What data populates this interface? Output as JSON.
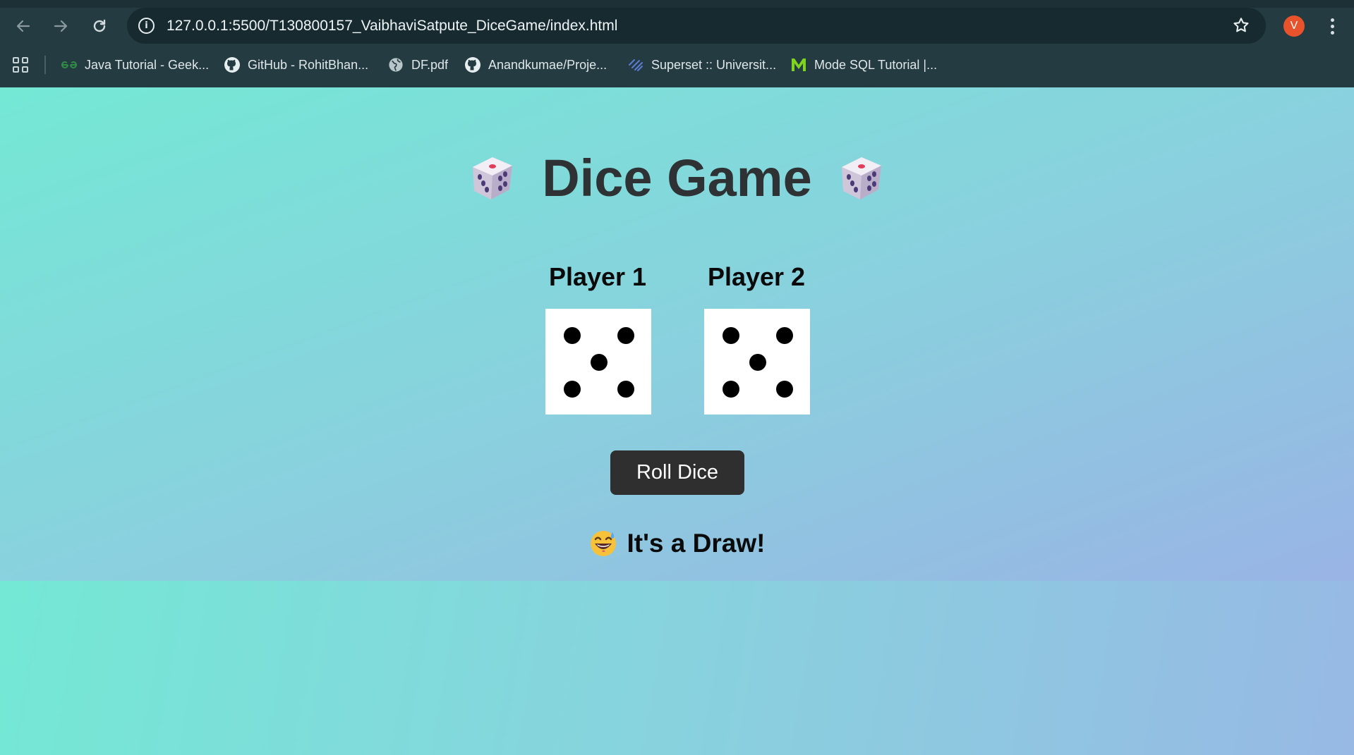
{
  "browser": {
    "url": "127.0.0.1:5500/T130800157_VaibhaviSatpute_DiceGame/index.html",
    "avatar_letter": "V",
    "avatar_color": "#e8532b",
    "bookmarks": [
      {
        "label": "Java Tutorial - Geek...",
        "icon": "geeksforgeeks-icon"
      },
      {
        "label": "GitHub - RohitBhan...",
        "icon": "github-icon"
      },
      {
        "label": "DF.pdf",
        "icon": "globe-icon"
      },
      {
        "label": "Anandkumae/Proje...",
        "icon": "github-icon"
      },
      {
        "label": "Superset :: Universit...",
        "icon": "superset-icon"
      },
      {
        "label": "Mode SQL Tutorial |...",
        "icon": "mode-icon"
      }
    ]
  },
  "game": {
    "title": "Dice Game",
    "players": [
      {
        "label": "Player 1",
        "die_value": 5
      },
      {
        "label": "Player 2",
        "die_value": 5
      }
    ],
    "roll_button_label": "Roll Dice",
    "result_text": "It's a Draw!",
    "result_icon": "grinning-sweat-emoji"
  },
  "colors": {
    "button_bg": "#2f2f2f",
    "title_text": "#2f3234",
    "chrome_bg": "#243b41"
  }
}
